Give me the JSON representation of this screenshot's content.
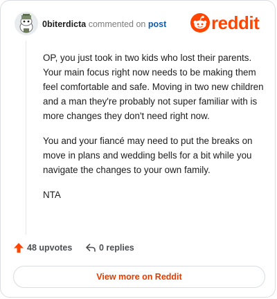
{
  "header": {
    "username": "0biterdicta",
    "action_text": "commented on",
    "post_link": "post",
    "brand_name": "reddit",
    "brand_color": "#ff4500"
  },
  "comment": {
    "paragraphs": [
      "OP, you just took in two kids who lost their parents. Your main focus right now needs to be making them feel comfortable and safe. Moving in two new children and a man they're probably not super familiar with is more changes they don't need right now.",
      "You and your fiancé may need to put the breaks on move in plans and wedding bells for a bit while you navigate the changes to your own family.",
      "NTA"
    ]
  },
  "actions": {
    "upvotes_label": "48 upvotes",
    "replies_label": "0 replies"
  },
  "footer": {
    "view_more_label": "View more on Reddit"
  },
  "icons": {
    "avatar": "snoo-avatar-icon",
    "brand": "reddit-snoo-icon",
    "upvote": "upvote-arrow-icon",
    "reply": "reply-arrow-icon"
  },
  "colors": {
    "accent": "#ff4500",
    "link": "#0b5db5",
    "view_more": "#e03c00"
  }
}
